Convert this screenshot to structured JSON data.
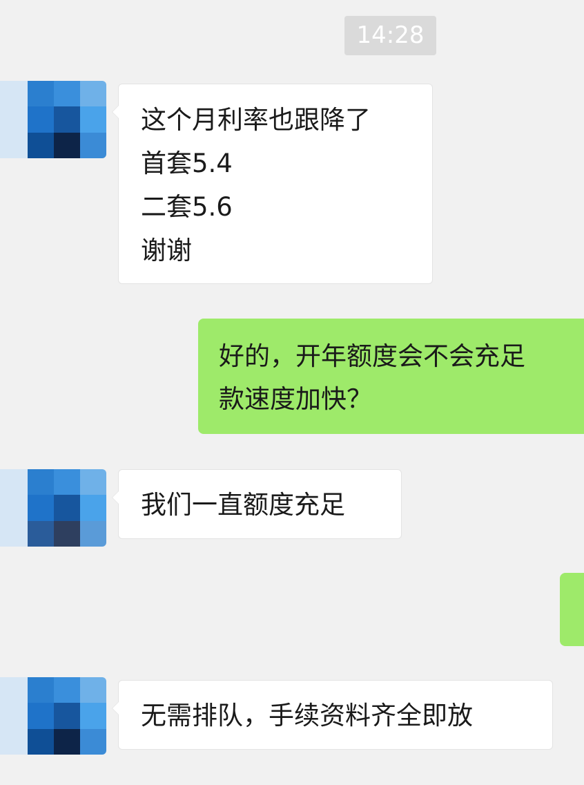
{
  "chat": {
    "timestamp": "14:28",
    "messages": [
      {
        "direction": "in",
        "lines": [
          "这个月利率也跟降了",
          "首套5.4",
          "二套5.6",
          "谢谢"
        ]
      },
      {
        "direction": "out",
        "lines": [
          "好的，开年额度会不会充足",
          "款速度加快？"
        ]
      },
      {
        "direction": "in",
        "lines": [
          "我们一直额度充足"
        ]
      },
      {
        "direction": "out",
        "lines": []
      },
      {
        "direction": "in",
        "lines": [
          "无需排队，手续资料齐全即放"
        ]
      }
    ]
  },
  "colors": {
    "background": "#f1f1f1",
    "incoming_bubble": "#ffffff",
    "outgoing_bubble": "#9eea6a",
    "timestamp_bg": "#dadada",
    "avatar_palette": [
      "#cfe0f1",
      "#2a7fd0",
      "#3b93df",
      "#1e6ab8",
      "#0f4f96",
      "#0d2a52",
      "#4aa3ea"
    ]
  }
}
